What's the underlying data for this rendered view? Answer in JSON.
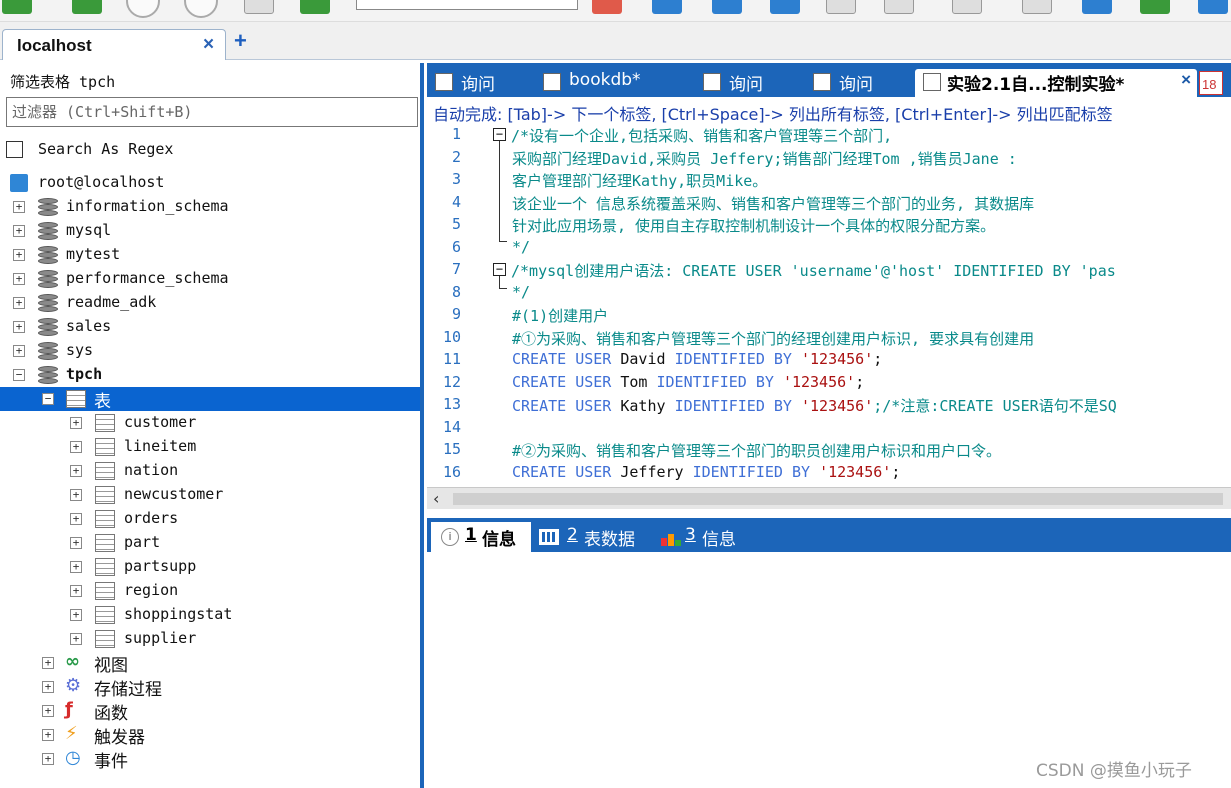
{
  "connection_tab": {
    "label": "localhost",
    "close": "×",
    "add": "+"
  },
  "left_panel": {
    "filter_title": "筛选表格 tpch",
    "filter_placeholder": "过滤器 (Ctrl+Shift+B)",
    "regex_label": "Search As Regex",
    "root": "root@localhost",
    "databases": [
      "information_schema",
      "mysql",
      "mytest",
      "performance_schema",
      "readme_adk",
      "sales",
      "sys"
    ],
    "current_db": "tpch",
    "tables_folder": "表",
    "tables": [
      "customer",
      "lineitem",
      "nation",
      "newcustomer",
      "orders",
      "part",
      "partsupp",
      "region",
      "shoppingstat",
      "supplier"
    ],
    "folders": [
      "视图",
      "存储过程",
      "函数",
      "触发器",
      "事件"
    ]
  },
  "query_tabs": [
    {
      "label": "询问",
      "active": false
    },
    {
      "label": "bookdb*",
      "active": false
    },
    {
      "label": "询问",
      "active": false
    },
    {
      "label": "询问",
      "active": false
    },
    {
      "label": "实验2.1自...控制实验*",
      "active": true,
      "close": "×"
    }
  ],
  "calendar_icon_text": "18",
  "autocomplete_hint": "自动完成: [Tab]-> 下一个标签, [Ctrl+Space]-> 列出所有标签, [Ctrl+Enter]-> 列出匹配标签",
  "editor_lines": [
    {
      "n": "1",
      "parts": [
        {
          "t": "/*设有一个企业,包括采购、销售和客户管理等三个部门,",
          "c": "cm"
        }
      ]
    },
    {
      "n": "2",
      "parts": [
        {
          "t": "采购部门经理David,采购员 Jeffery;销售部门经理Tom ,销售员Jane :",
          "c": "cm"
        }
      ]
    },
    {
      "n": "3",
      "parts": [
        {
          "t": "客户管理部门经理Kathy,职员Mike。",
          "c": "cm"
        }
      ]
    },
    {
      "n": "4",
      "parts": [
        {
          "t": "该企业一个 信息系统覆盖采购、销售和客户管理等三个部门的业务, 其数据库",
          "c": "cm"
        }
      ]
    },
    {
      "n": "5",
      "parts": [
        {
          "t": "针对此应用场景, 使用自主存取控制机制设计一个具体的权限分配方案。",
          "c": "cm"
        }
      ]
    },
    {
      "n": "6",
      "parts": [
        {
          "t": "*/",
          "c": "cm"
        }
      ]
    },
    {
      "n": "7",
      "parts": [
        {
          "t": "/*mysql创建用户语法: CREATE USER 'username'@'host' IDENTIFIED BY 'pas",
          "c": "cm"
        }
      ]
    },
    {
      "n": "8",
      "parts": [
        {
          "t": "*/",
          "c": "cm"
        }
      ]
    },
    {
      "n": "9",
      "parts": [
        {
          "t": "#(1)创建用户",
          "c": "cm"
        }
      ]
    },
    {
      "n": "10",
      "parts": [
        {
          "t": "#①为采购、销售和客户管理等三个部门的经理创建用户标识, 要求具有创建用",
          "c": "cm"
        }
      ]
    },
    {
      "n": "11",
      "parts": [
        {
          "t": "CREATE USER ",
          "c": "kw"
        },
        {
          "t": "David ",
          "c": "id"
        },
        {
          "t": "IDENTIFIED BY ",
          "c": "kw"
        },
        {
          "t": "'123456'",
          "c": "str"
        },
        {
          "t": ";",
          "c": "id"
        }
      ]
    },
    {
      "n": "12",
      "parts": [
        {
          "t": "CREATE USER ",
          "c": "kw"
        },
        {
          "t": "Tom ",
          "c": "id"
        },
        {
          "t": "IDENTIFIED BY ",
          "c": "kw"
        },
        {
          "t": "'123456'",
          "c": "str"
        },
        {
          "t": ";",
          "c": "id"
        }
      ]
    },
    {
      "n": "13",
      "parts": [
        {
          "t": "CREATE USER ",
          "c": "kw"
        },
        {
          "t": "Kathy ",
          "c": "id"
        },
        {
          "t": "IDENTIFIED BY ",
          "c": "kw"
        },
        {
          "t": "'123456'",
          "c": "str"
        },
        {
          "t": ";/*注意:CREATE USER语句不是SQ",
          "c": "cm"
        }
      ]
    },
    {
      "n": "14",
      "parts": []
    },
    {
      "n": "15",
      "parts": [
        {
          "t": "#②为采购、销售和客户管理等三个部门的职员创建用户标识和用户口令。",
          "c": "cm"
        }
      ]
    },
    {
      "n": "16",
      "parts": [
        {
          "t": "CREATE USER ",
          "c": "kw"
        },
        {
          "t": "Jeffery ",
          "c": "id"
        },
        {
          "t": "IDENTIFIED BY ",
          "c": "kw"
        },
        {
          "t": "'123456'",
          "c": "str"
        },
        {
          "t": ";",
          "c": "id"
        }
      ]
    }
  ],
  "result_tabs": [
    {
      "num": "1",
      "label": "信息",
      "active": true
    },
    {
      "num": "2",
      "label": "表数据",
      "active": false
    },
    {
      "num": "3",
      "label": "信息",
      "active": false
    }
  ],
  "watermark": "CSDN @摸鱼小玩子",
  "colors": {
    "accent": "#1c65b9",
    "selected": "#0a64d0",
    "comment": "#0a8a8a",
    "keyword": "#3f6fd6",
    "string": "#a11"
  }
}
